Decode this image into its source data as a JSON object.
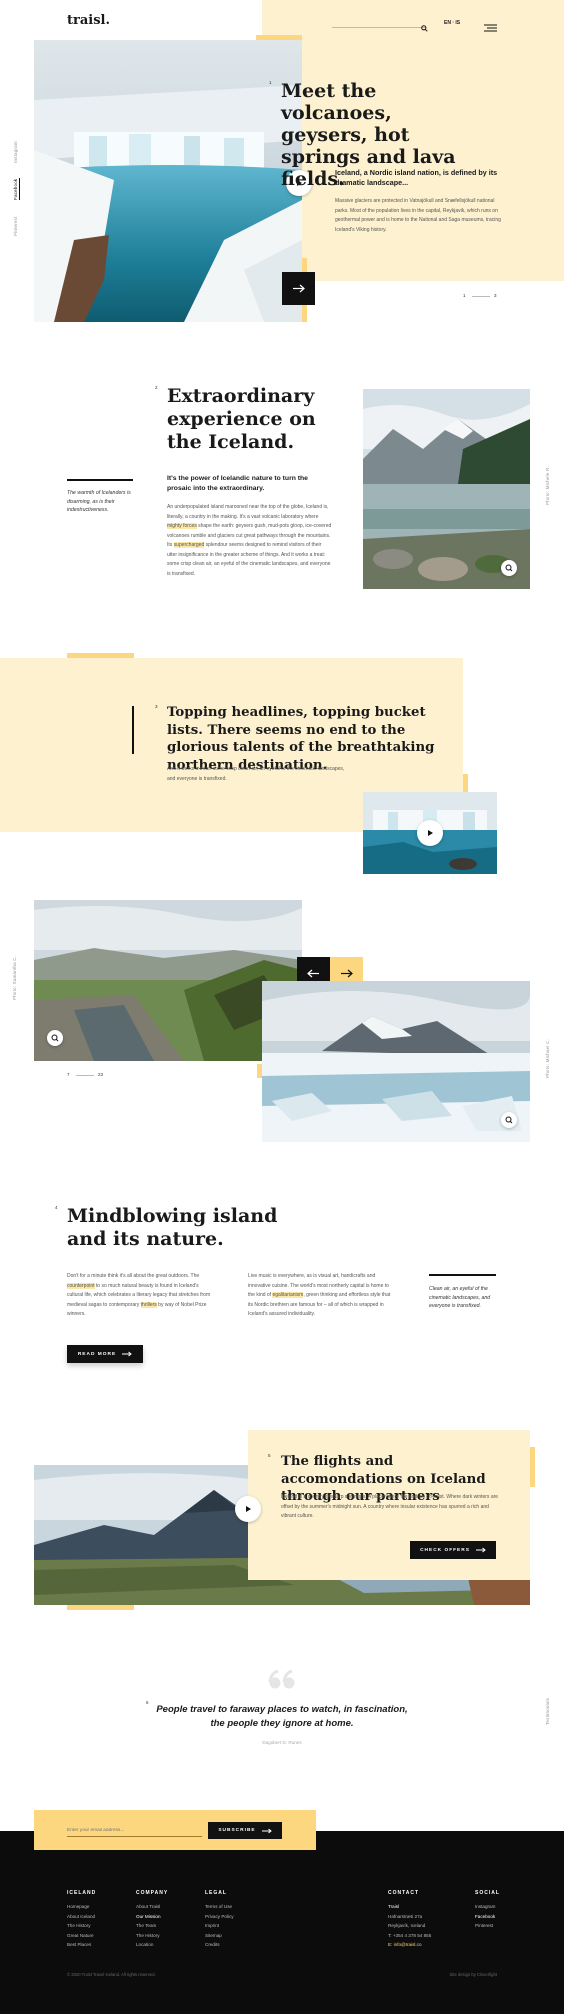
{
  "header": {
    "logo": "traisl.",
    "lang": "EN · IS"
  },
  "side_social": [
    "Instagram",
    "Facebook",
    "Pinterest"
  ],
  "hero": {
    "num": "1",
    "title": "Meet the volcanoes, geysers, hot springs and lava fields.",
    "subtitle": "Iceland, a Nordic island nation, is defined by its dramatic landscape...",
    "body": "Massive glaciers are protected in Vatnajökull and Snæfellsjökull national parks. Most of the population lives in the capital, Reykjavik, which runs on geothermal power and is home to the National and Saga museums, tracing Iceland's Viking history.",
    "pager_current": "1",
    "pager_total": "3"
  },
  "section2": {
    "num": "2",
    "title": "Extraordinary experience on the Iceland.",
    "quote": "The warmth of Icelanders is disarming, as is their indestructiveness.",
    "lead": "It's the power of Icelandic nature to turn the prosaic into the extraordinary.",
    "body_a": "An underpopulated island marooned near the top of the globe, Iceland is, literally, a country in the making. It's a vast volcanic laboratory where ",
    "hl1": "mighty forces",
    "body_b": " shape the earth: geysers gush, mud-pots gloop, ice-covered volcanoes rumble and glaciers cut great pathways through the mountains. Its ",
    "hl2": "supercharged",
    "body_c": " splendour seems designed to remind visitors of their utter insignificance in the greater scheme of things. And it works a treat: some crisp clean air, an eyeful of the cinematic landscapes, and everyone is transfixed.",
    "photo_credit": "Photo: Michele R."
  },
  "section3": {
    "num": "3",
    "title": "Topping headlines, topping bucket lists. There seems no end to the glorious talents of the breathtaking northern destination.",
    "body": "And it works a treat: some crisp clean air, an eyeful of the cinematic landscapes, and everyone is transfixed."
  },
  "gallery": {
    "credit_left": "Photo: Samantha C.",
    "credit_right": "Photo: Michael C.",
    "pager_current": "7",
    "pager_total": "23"
  },
  "section4": {
    "num": "4",
    "title": "Mindblowing island and its nature.",
    "col1_a": "Don't for a minute think it's all about the great outdoors. The ",
    "col1_hl": "counterpoint",
    "col1_b": " to so much natural beauty is found in Iceland's cultural life, which celebrates a literary legacy that stretches from medieval sagas to contemporary ",
    "col1_hl2": "thrillers",
    "col1_c": " by way of Nobel Prize winners.",
    "col2_a": "Live music is everywhere, as is visual art, handicrafts and innovative cuisine. The world's most northerly capital is home to the kind of ",
    "col2_hl": "egalitarianism",
    "col2_b": ", green thinking and effortless style that its Nordic brethren are famous for – all of which is wrapped in Iceland's assured individuality.",
    "quote": "Clean air, an eyeful of the cinematic landscapes, and everyone is transfixed.",
    "button": "READ MORE"
  },
  "section5": {
    "num": "5",
    "title": "The flights and accomondations on Iceland through our partners",
    "body": "Iceland is a country of sharp contrasts. A place where fire and ice co-exist. Where dark winters are offset by the summer's midnight sun. A country where insular existence has spurred a rich and vibrant culture.",
    "button": "CHECK OFFERS"
  },
  "testimonial": {
    "num": "6",
    "quote": "People travel to faraway places to watch, in fascination, the people they ignore at home.",
    "author": "Dagobert D. Runes",
    "side": "Testimonials"
  },
  "newsletter": {
    "placeholder": "Enter your email address...",
    "button": "SUBSCRIBE"
  },
  "footer": {
    "columns": [
      {
        "title": "ICELAND",
        "links": [
          "Homepage",
          "About Iceland",
          "The History",
          "Great Nature",
          "Best Places"
        ]
      },
      {
        "title": "COMPANY",
        "links": [
          "About Traisl",
          "Our Mission",
          "The Team",
          "The History",
          "Location"
        ]
      },
      {
        "title": "LEGAL",
        "links": [
          "Terms of Use",
          "Privacy Policy",
          "Imprint",
          "Sitemap",
          "Credits"
        ]
      }
    ],
    "contact": {
      "title": "CONTACT",
      "lines": [
        "Traisl",
        "Hafnarstræti 27a",
        "Reykjavík, Iceland",
        "T: +354 4 378 54 855",
        "E: info@traisl.co"
      ]
    },
    "social": {
      "title": "SOCIAL",
      "links": [
        "Instagram",
        "Facebook",
        "Pinterest"
      ]
    },
    "copyright": "© 2020 Traisl Travel Iceland. All rights reserved.",
    "credit": "Site design by Cloverfight"
  },
  "colors": {
    "cream": "#fdf1cf",
    "yellow": "#fcd77f",
    "dark": "#111111"
  }
}
